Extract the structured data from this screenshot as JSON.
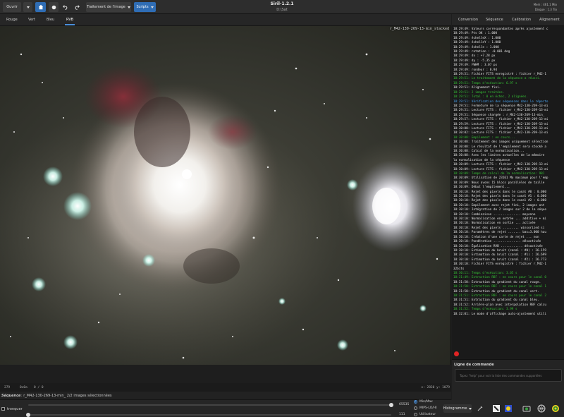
{
  "header": {
    "open_label": "Ouvrir",
    "processing_label": "Traitement de l'image",
    "scripts_label": "Scripts",
    "app_title": "Siril-1.2.1",
    "working_dir": "D:\\Sat",
    "memory": "Mem : 461.1 Mio",
    "disk": "Disque : 1.3 Tio"
  },
  "channels": [
    "Rouge",
    "Vert",
    "Bleu",
    "RVB"
  ],
  "right_tabs": [
    "Conversion",
    "Séquence",
    "Calibration",
    "Alignement"
  ],
  "image": {
    "filename": "r_M42-130-269-13-min_stacked"
  },
  "readout": {
    "r": "R=0.4884",
    "g": "G=0.5244",
    "b": "B=0.6199"
  },
  "status": {
    "zoom": "279",
    "bits": "0x0a",
    "extra": "0 / 0",
    "coords": "x: 2830  y: 1079"
  },
  "sequence": {
    "label": "Séquence",
    "info": ": r_M42-130-269-13-min_  2/2 images sélectionnées"
  },
  "controls": {
    "tronquer": "tronquer",
    "max_value": "65535",
    "min_value": "111",
    "modes": [
      "Min/Max",
      "MIPS-LO/HI",
      "Utilisateur"
    ],
    "scale": "Histogramme"
  },
  "command": {
    "label": "Ligne de commande",
    "placeholder": "Tapez \"help\" pour voir la liste des commandes supportées"
  },
  "log": [
    {
      "t": "18:29:49: Valeurs correspondantes après ajustement c",
      "c": ""
    },
    {
      "t": "18:29:49: Pts OK :       1.000",
      "c": ""
    },
    {
      "t": "18:29:49: échelleX :     1.000",
      "c": ""
    },
    {
      "t": "18:29:49: échelleY :     1.000",
      "c": ""
    },
    {
      "t": "18:29:49: échelle :      1.000",
      "c": ""
    },
    {
      "t": "18:29:49: rotation :    -0.001 deg",
      "c": ""
    },
    {
      "t": "18:29:49: dx :          +7.28 px",
      "c": ""
    },
    {
      "t": "18:29:49: dy :          -5.35 px",
      "c": ""
    },
    {
      "t": "18:29:49: FWHM :         3.07 px",
      "c": ""
    },
    {
      "t": "18:29:49: rondeur :      0.94",
      "c": ""
    },
    {
      "t": "18:29:51: Fichier FITS enregistré : fichier r_M42-1",
      "c": ""
    },
    {
      "t": "18:29:51: Le traitement de la séquence a réussi.",
      "c": "g"
    },
    {
      "t": "18:29:51: Temps d'exécution: 6.97 s",
      "c": "g"
    },
    {
      "t": "18:29:51: Alignement fini.",
      "c": ""
    },
    {
      "t": "18:29:51: 2 images traitées.",
      "c": "g"
    },
    {
      "t": "18:29:51: Total : 0 en échec, 2 alignées.",
      "c": "g"
    },
    {
      "t": "18:29:51: Vérification des séquences dans le réperto",
      "c": "b"
    },
    {
      "t": "18:29:51: Fermeture de la séquence M42-130-269-13-mi",
      "c": ""
    },
    {
      "t": "18:29:51: Lecture FITS : fichier r_M42-130-269-13-mi",
      "c": ""
    },
    {
      "t": "18:29:51: Séquence chargée : r_M42-130-269-13-min_",
      "c": ""
    },
    {
      "t": "18:29:57: Lecture FITS : fichier r_M42-130-269-13-mi",
      "c": ""
    },
    {
      "t": "18:29:59: Lecture FITS : fichier r_M42-130-269-13-mi",
      "c": ""
    },
    {
      "t": "18:30:00: Lecture FITS : fichier r_M42-130-269-13-mi",
      "c": ""
    },
    {
      "t": "18:30:02: Lecture FITS : fichier r_M42-130-269-13-mi",
      "c": ""
    },
    {
      "t": "18:30:08: Empilement : en cours...",
      "c": "g"
    },
    {
      "t": "18:30:08: Traitement des images uniquement sélection",
      "c": ""
    },
    {
      "t": "18:30:08: Le résultat de l'empilement sera stocké a",
      "c": ""
    },
    {
      "t": "18:30:08: Calcul de la normalisation...",
      "c": ""
    },
    {
      "t": "18:30:08: Avec les limites actuelles de la mémoire",
      "c": ""
    },
    {
      "t": "la normalisation de la séquence",
      "c": ""
    },
    {
      "t": "18:30:09: Lecture FITS : fichier r_M42-130-269-13-mi",
      "c": ""
    },
    {
      "t": "18:30:09: Lecture FITS : fichier r_M42-130-269-13-mi",
      "c": ""
    },
    {
      "t": "18:30:09: Temps de calcul de la normalisation: 981",
      "c": "g"
    },
    {
      "t": "18:30:09: Utilisation de 23161 Mo maximum pour l'emp",
      "c": ""
    },
    {
      "t": "18:30:09: Nous avons 15 blocs parallèles de taille",
      "c": ""
    },
    {
      "t": "18:30:09: Début l'empilement...",
      "c": ""
    },
    {
      "t": "18:30:10: Rejet des pixels dans le canal #0 : 0.000",
      "c": ""
    },
    {
      "t": "18:30:10: Rejet des pixels dans le canal #1 : 0.000",
      "c": ""
    },
    {
      "t": "18:30:10: Rejet des pixels dans le canal #2 : 0.000",
      "c": ""
    },
    {
      "t": "18:30:10: Empilement avec rejet fini, 2 images ont",
      "c": ""
    },
    {
      "t": "18:30:10: Intégration de 2 images sur 2 de la séque",
      "c": ""
    },
    {
      "t": "18:30:10: Combinaison ............... moyenne",
      "c": ""
    },
    {
      "t": "18:30:10: Normalisation en entrée ... additive + mi",
      "c": ""
    },
    {
      "t": "18:30:10: Normalisation en sortie ... activée",
      "c": ""
    },
    {
      "t": "18:30:10: Rejet des pixels ......... winsorized si",
      "c": ""
    },
    {
      "t": "18:30:10: Paramètres de rejet ....... bas=3.000 hau",
      "c": ""
    },
    {
      "t": "18:30:10: Création d'une carte de rejet ... non",
      "c": ""
    },
    {
      "t": "18:30:10: Pondération ............... désactivée",
      "c": ""
    },
    {
      "t": "18:30:10: Égalisation RVB ............ désactivée",
      "c": ""
    },
    {
      "t": "18:30:10: Estimation du bruit (canal : #0) : 26.159",
      "c": ""
    },
    {
      "t": "18:30:10: Estimation du bruit (canal : #1) : 26.699",
      "c": ""
    },
    {
      "t": "18:30:10: Estimation du bruit (canal : #2) : 26.773",
      "c": ""
    },
    {
      "t": "18:30:10: Fichier FITS enregistré : fichier r_M42-1",
      "c": ""
    },
    {
      "t": "32bits",
      "c": ""
    },
    {
      "t": "18:30:11: Temps d'exécution: 3.05 s",
      "c": "g"
    },
    {
      "t": "18:31:49: Extraction RBF : en cours pour le canal 0",
      "c": "g"
    },
    {
      "t": "18:31:50: Extraction du gradient du canal rouge.",
      "c": ""
    },
    {
      "t": "18:31:50: Extraction RBF : en cours pour le canal 1",
      "c": "g"
    },
    {
      "t": "18:31:50: Extraction du gradient du canal vert.",
      "c": ""
    },
    {
      "t": "18:31:51: Extraction RBF : en cours pour le canal 2",
      "c": "g"
    },
    {
      "t": "18:31:51: Extraction du gradient du canal bleu.",
      "c": ""
    },
    {
      "t": "18:31:52: Arrière-plan avec interpolation RBF calcu",
      "c": ""
    },
    {
      "t": "18:31:52: Temps d'exécution: 3.99 s",
      "c": "g"
    },
    {
      "t": "18:32:01: Le mode d'affichage auto-ajustement utili",
      "c": ""
    }
  ]
}
